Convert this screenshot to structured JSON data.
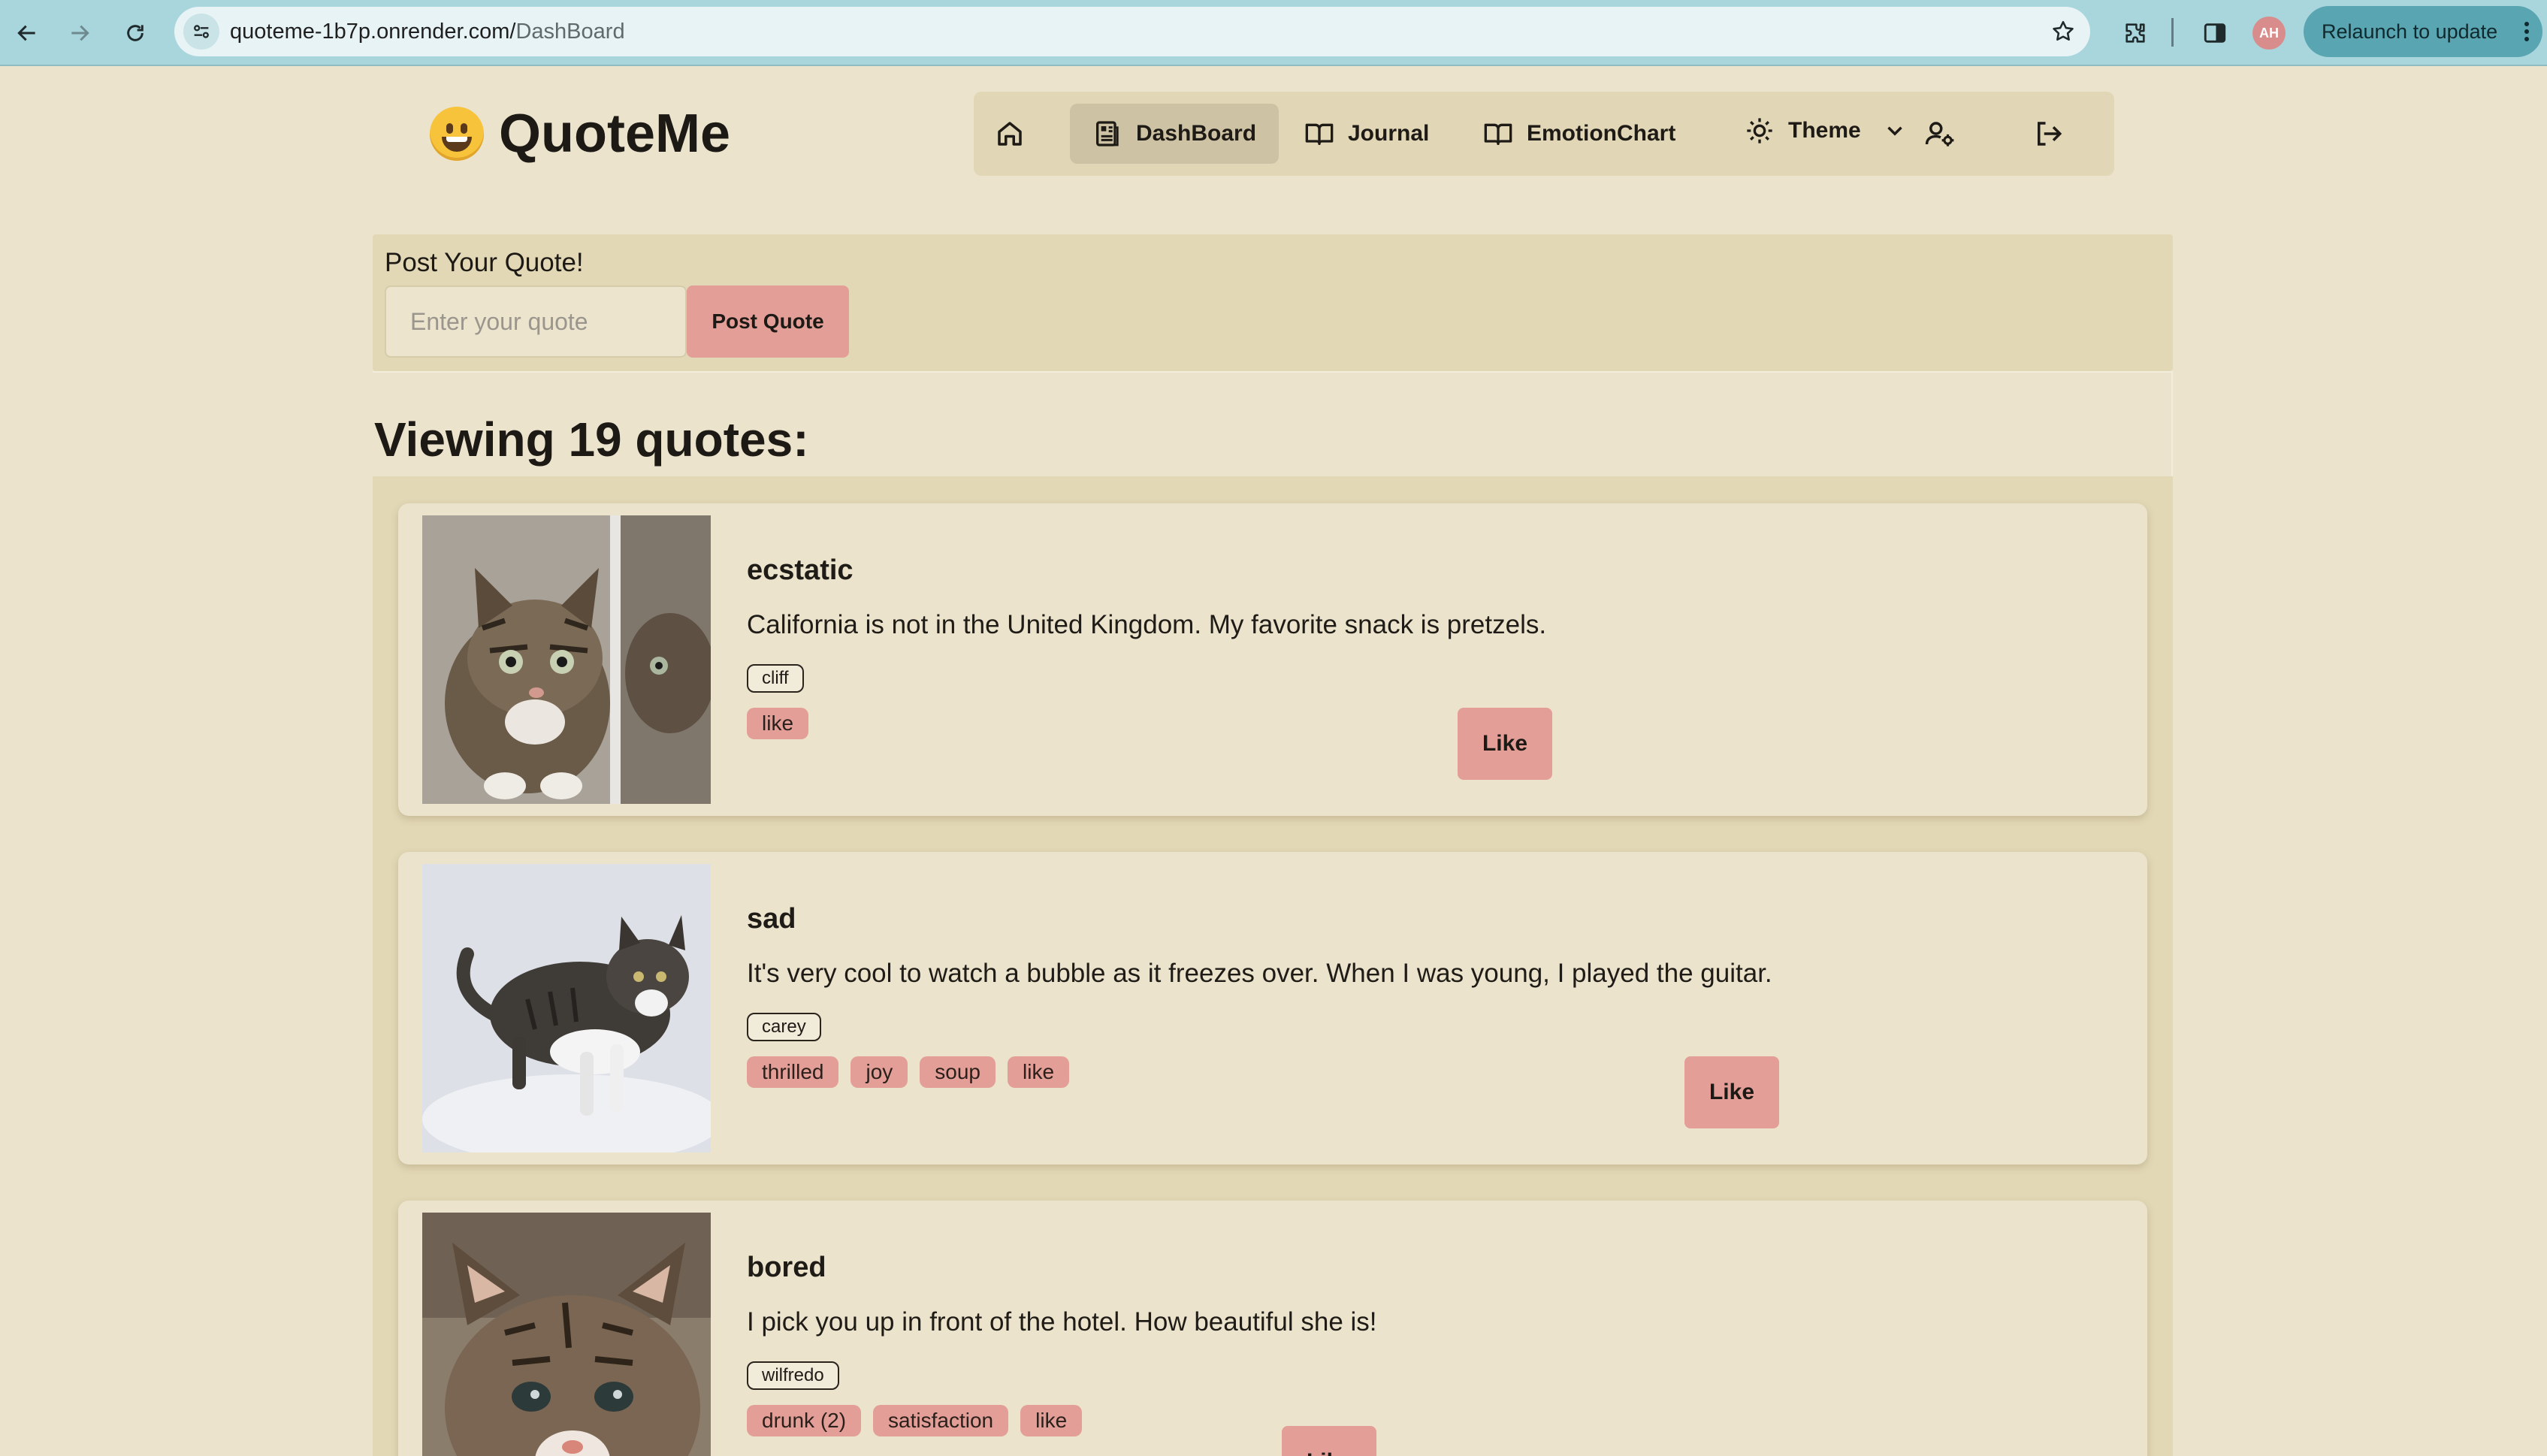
{
  "browser": {
    "url_host": "quoteme-1b7p.onrender.com/",
    "url_path": "DashBoard",
    "profile_initials": "AH",
    "relaunch_label": "Relaunch to update"
  },
  "app": {
    "name": "QuoteMe",
    "logo_emoji": "grinning-face-icon"
  },
  "nav": {
    "home_icon": "home-icon",
    "dashboard": "DashBoard",
    "journal": "Journal",
    "emotion_chart": "EmotionChart",
    "theme": "Theme",
    "settings_icon": "user-settings-icon",
    "logout_icon": "logout-icon"
  },
  "post": {
    "label": "Post Your Quote!",
    "placeholder": "Enter your quote",
    "value": "",
    "button": "Post Quote"
  },
  "feed": {
    "heading": "Viewing 19 quotes:",
    "quotes": [
      {
        "emotion": "ecstatic",
        "text": "California is not in the United Kingdom. My favorite snack is pretzels.",
        "author": "cliff",
        "tags": [
          "like"
        ],
        "like_label": "Like"
      },
      {
        "emotion": "sad",
        "text": "It's very cool to watch a bubble as it freezes over. When I was young, I played the guitar.",
        "author": "carey",
        "tags": [
          "thrilled",
          "joy",
          "soup",
          "like"
        ],
        "like_label": "Like"
      },
      {
        "emotion": "bored",
        "text": "I pick you up in front of the hotel. How beautiful she is!",
        "author": "wilfredo",
        "tags": [
          "drunk (2)",
          "satisfaction",
          "like"
        ],
        "like_label": "Like"
      }
    ]
  },
  "colors": {
    "page_bg": "#ebe3cc",
    "panel_bg": "#e2d8b6",
    "accent": "#e39f97",
    "chrome_bg": "#a8d6dc"
  }
}
